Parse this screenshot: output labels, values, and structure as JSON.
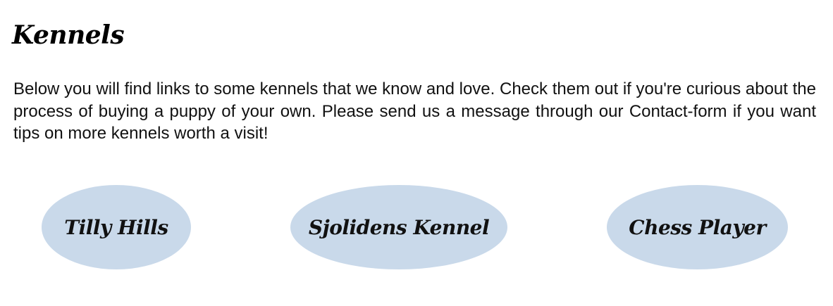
{
  "page": {
    "title": "Kennels",
    "intro": "Below you will find links to some kennels that we know and love. Check them out if you're curious about the process of buying a puppy of your own. Please send us a message through our Contact-form if you want tips on more kennels worth a visit!"
  },
  "kennels": [
    {
      "label": "Tilly Hills"
    },
    {
      "label": "Sjolidens Kennel"
    },
    {
      "label": "Chess Player"
    }
  ],
  "colors": {
    "link_background": "#c9d9ea",
    "text": "#111111"
  }
}
